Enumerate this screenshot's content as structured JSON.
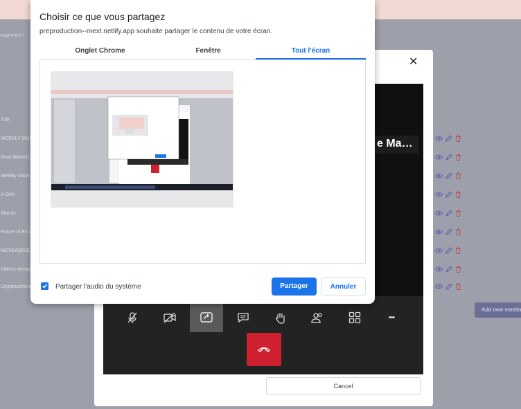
{
  "background": {
    "breadcrumb": "nagement  /",
    "column_title": "Title",
    "rows": [
      "WEEKLY MUS",
      "Must Marketi",
      "Weekly show",
      "H DAY",
      "Stands",
      "Future of Ev C",
      "METAVERSE E",
      "Videos-stream",
      "Cryptocurrenc"
    ],
    "add_button": "Add new meetin"
  },
  "meeting": {
    "video_title": "e Ma…",
    "cancel_label": "Cancel",
    "controls": [
      "mic-off-icon",
      "camera-off-icon",
      "share-screen-icon",
      "chat-icon",
      "raise-hand-icon",
      "participants-icon",
      "grid-icon",
      "more-icon"
    ],
    "more_glyph": "•••"
  },
  "dialog": {
    "title": "Choisir ce que vous partagez",
    "subtitle": "preproduction--mext.netlify.app souhaite partager le contenu de votre écran.",
    "tabs": [
      "Onglet Chrome",
      "Fenêtre",
      "Tout l'écran"
    ],
    "selected_tab": 2,
    "audio_checked": true,
    "audio_label": "Partager l'audio du système",
    "share_label": "Partager",
    "cancel_label": "Annuler"
  },
  "colors": {
    "accent": "#1a73e8",
    "hangup": "#cf2030",
    "overlay": "#9da0ab",
    "banner": "#f3d9d3"
  }
}
